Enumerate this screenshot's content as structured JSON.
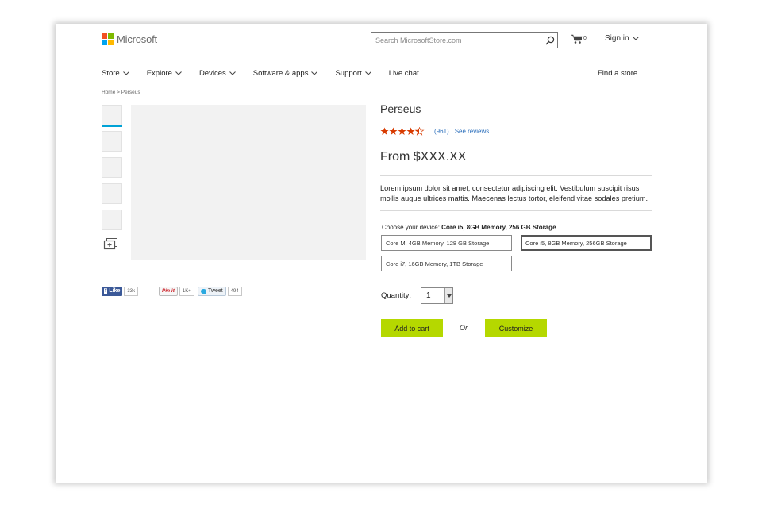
{
  "colors": {
    "accent_green": "#b5d800",
    "link_blue": "#2a6ebb",
    "star_orange": "#d83b01",
    "thumb_active": "#00a2d6",
    "logo_red": "#f25022",
    "logo_green": "#7fba00",
    "logo_blue": "#00a4ef",
    "logo_yellow": "#ffb900"
  },
  "header": {
    "brand": "Microsoft",
    "search_placeholder": "Search MicrosoftStore.com",
    "cart_count": "0",
    "signin_label": "Sign in"
  },
  "nav": {
    "items": [
      {
        "label": "Store",
        "has_dropdown": true
      },
      {
        "label": "Explore",
        "has_dropdown": true
      },
      {
        "label": "Devices",
        "has_dropdown": true
      },
      {
        "label": "Software & apps",
        "has_dropdown": true
      },
      {
        "label": "Support",
        "has_dropdown": true
      },
      {
        "label": "Live chat",
        "has_dropdown": false
      }
    ],
    "find_store": "Find a store"
  },
  "breadcrumb": "Home > Perseus",
  "social": {
    "fb_label": "Like",
    "fb_count": "33k",
    "pin_label": "Pin it",
    "pin_count": "1K+",
    "tweet_label": "Tweet",
    "tweet_count": "494"
  },
  "product": {
    "title": "Perseus",
    "rating_value": 4.5,
    "rating_max": 5,
    "rating_count": "(961)",
    "see_reviews": "See reviews",
    "price": "From $XXX.XX",
    "description": "Lorem ipsum dolor sit amet, consectetur adipiscing elit. Vestibulum suscipit risus mollis augue ultrices mattis. Maecenas lectus tortor, eleifend vitae sodales pretium.",
    "choose_label": "Choose your device:",
    "choose_value": "Core i5, 8GB Memory, 256 GB Storage",
    "options": [
      {
        "label": "Core M, 4GB Memory, 128 GB Storage",
        "selected": false
      },
      {
        "label": "Core i5, 8GB Memory, 256GB Storage",
        "selected": true
      },
      {
        "label": "Core i7, 16GB Memory, 1TB Storage",
        "selected": false
      }
    ],
    "quantity_label": "Quantity:",
    "quantity_value": "1",
    "add_to_cart": "Add to cart",
    "or_label": "Or",
    "customize": "Customize"
  }
}
